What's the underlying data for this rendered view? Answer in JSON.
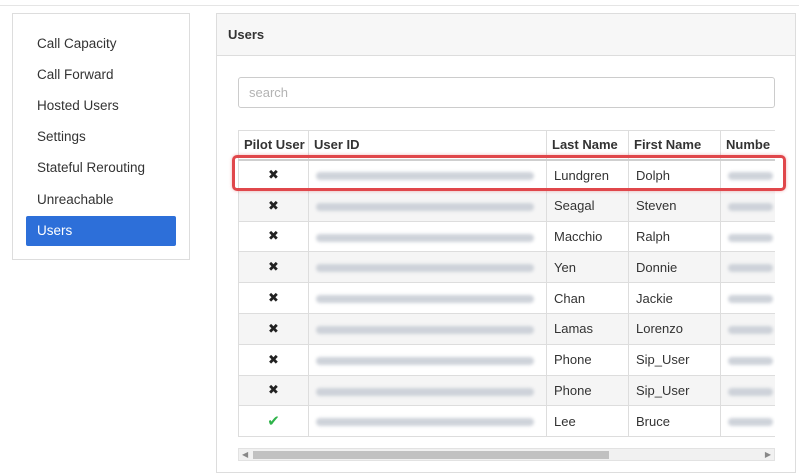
{
  "sidebar": {
    "items": [
      {
        "label": "Call Capacity"
      },
      {
        "label": "Call Forward"
      },
      {
        "label": "Hosted Users"
      },
      {
        "label": "Settings"
      },
      {
        "label": "Stateful Rerouting"
      },
      {
        "label": "Unreachable"
      },
      {
        "label": "Users",
        "active": true
      }
    ]
  },
  "panel": {
    "title": "Users",
    "search_placeholder": "search"
  },
  "table": {
    "columns": [
      "Pilot User",
      "User ID",
      "Last Name",
      "First Name",
      "Numbe"
    ],
    "rows": [
      {
        "pilot": "✖",
        "last": "Lundgren",
        "first": "Dolph",
        "highlighted": true
      },
      {
        "pilot": "✖",
        "last": "Seagal",
        "first": "Steven"
      },
      {
        "pilot": "✖",
        "last": "Macchio",
        "first": "Ralph"
      },
      {
        "pilot": "✖",
        "last": "Yen",
        "first": "Donnie"
      },
      {
        "pilot": "✖",
        "last": "Chan",
        "first": "Jackie"
      },
      {
        "pilot": "✖",
        "last": "Lamas",
        "first": "Lorenzo"
      },
      {
        "pilot": "✖",
        "last": "Phone",
        "first": "Sip_User"
      },
      {
        "pilot": "✖",
        "last": "Phone",
        "first": "Sip_User"
      },
      {
        "pilot": "✔",
        "last": "Lee",
        "first": "Bruce"
      }
    ]
  },
  "colors": {
    "active_nav": "#2d6fd9",
    "highlight": "#e0474b",
    "check": "#2fb34a"
  }
}
